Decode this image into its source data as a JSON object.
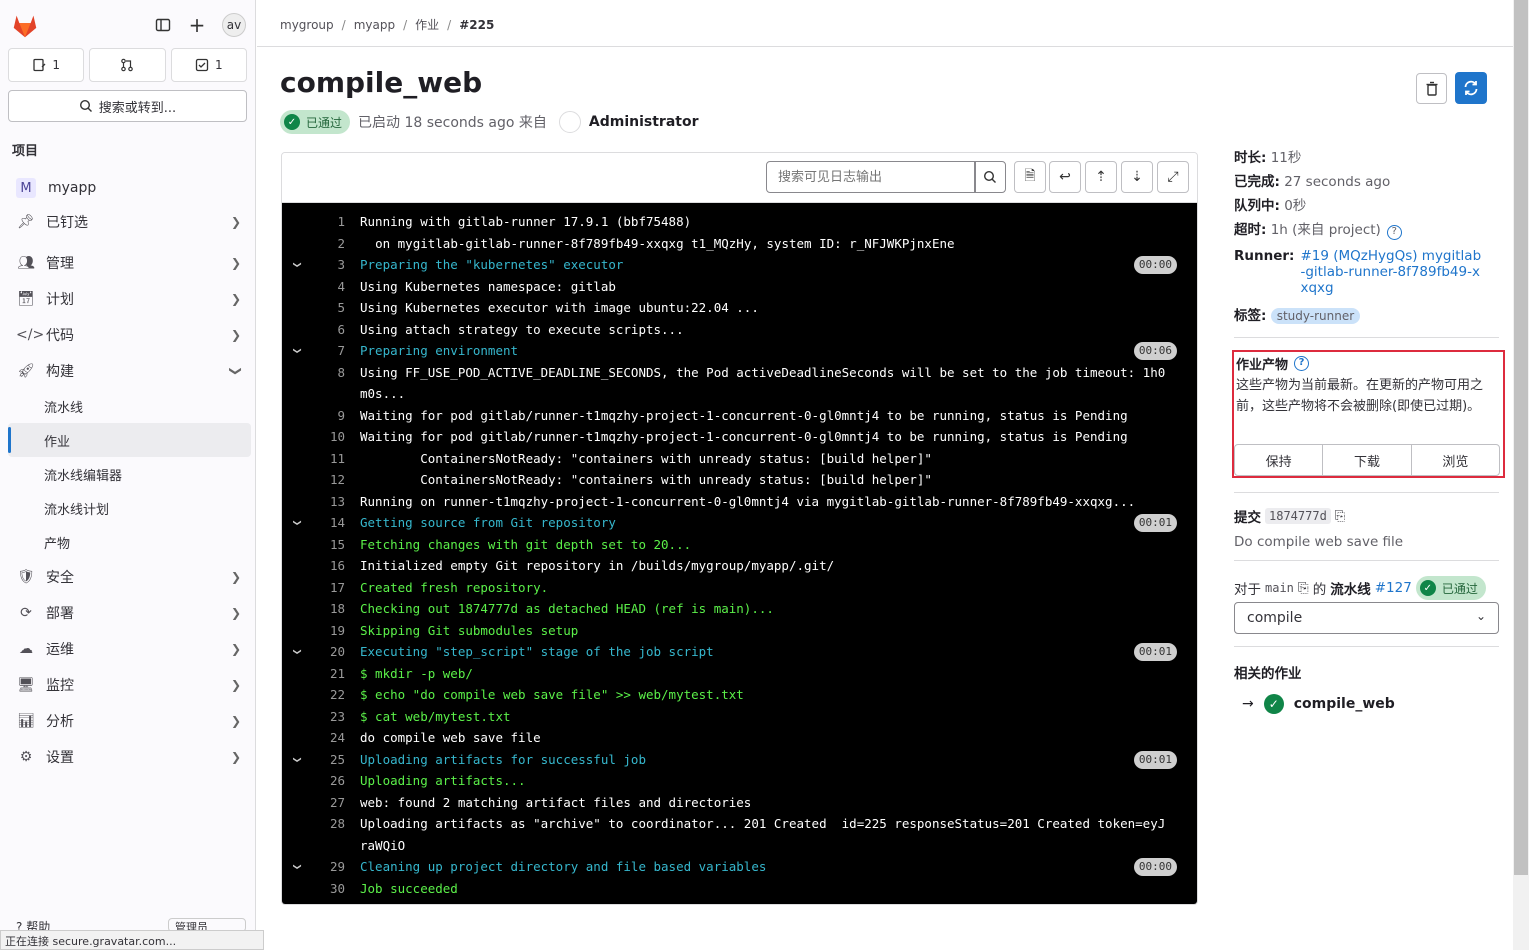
{
  "sidebar": {
    "avatar": "av",
    "counts": {
      "issues": "1",
      "mrs": "",
      "todos": "1"
    },
    "search_label": "搜索或转到...",
    "section_title": "项目",
    "project": {
      "initial": "M",
      "name": "myapp"
    },
    "items": [
      {
        "label": "已钉选"
      },
      {
        "label": "管理"
      },
      {
        "label": "计划"
      },
      {
        "label": "代码"
      },
      {
        "label": "构建"
      },
      {
        "label": "安全"
      },
      {
        "label": "部署"
      },
      {
        "label": "运维"
      },
      {
        "label": "监控"
      },
      {
        "label": "分析"
      },
      {
        "label": "设置"
      }
    ],
    "build_sub": [
      "流水线",
      "作业",
      "流水线编辑器",
      "流水线计划",
      "产物"
    ],
    "help": "帮助",
    "admin": "管理员"
  },
  "statusbar": "正在连接 secure.gravatar.com...",
  "breadcrumb": [
    "mygroup",
    "myapp",
    "作业",
    "#225"
  ],
  "job": {
    "title": "compile_web",
    "status": "已通过",
    "started": "已启动 18 seconds ago 来自",
    "user": "Administrator"
  },
  "log": {
    "search_placeholder": "搜索可见日志输出",
    "lines": [
      {
        "n": "1",
        "t": "Running with gitlab-runner 17.9.1 (bbf75488)",
        "c": "c-wht"
      },
      {
        "n": "2",
        "t": "  on mygitlab-gitlab-runner-8f789fb49-xxqxg t1_MQzHy, system ID: r_NFJWKPjnxEne",
        "c": "c-wht"
      },
      {
        "n": "3",
        "t": "Preparing the \"kubernetes\" executor",
        "c": "c-sec",
        "dur": "00:00"
      },
      {
        "n": "4",
        "t": "Using Kubernetes namespace: gitlab",
        "c": "c-wht"
      },
      {
        "n": "5",
        "t": "Using Kubernetes executor with image ubuntu:22.04 ...",
        "c": "c-wht"
      },
      {
        "n": "6",
        "t": "Using attach strategy to execute scripts...",
        "c": "c-wht"
      },
      {
        "n": "7",
        "t": "Preparing environment",
        "c": "c-sec",
        "dur": "00:06"
      },
      {
        "n": "8",
        "t": "Using FF_USE_POD_ACTIVE_DEADLINE_SECONDS, the Pod activeDeadlineSeconds will be set to the job timeout: 1h0m0s...",
        "c": "c-wht"
      },
      {
        "n": "9",
        "t": "Waiting for pod gitlab/runner-t1mqzhy-project-1-concurrent-0-gl0mntj4 to be running, status is Pending",
        "c": "c-wht"
      },
      {
        "n": "10",
        "t": "Waiting for pod gitlab/runner-t1mqzhy-project-1-concurrent-0-gl0mntj4 to be running, status is Pending",
        "c": "c-wht"
      },
      {
        "n": "11",
        "t": "        ContainersNotReady: \"containers with unready status: [build helper]\"",
        "c": "c-wht"
      },
      {
        "n": "12",
        "t": "        ContainersNotReady: \"containers with unready status: [build helper]\"",
        "c": "c-wht"
      },
      {
        "n": "13",
        "t": "Running on runner-t1mqzhy-project-1-concurrent-0-gl0mntj4 via mygitlab-gitlab-runner-8f789fb49-xxqxg...",
        "c": "c-wht"
      },
      {
        "n": "14",
        "t": "Getting source from Git repository",
        "c": "c-sec",
        "dur": "00:01"
      },
      {
        "n": "15",
        "t": "Fetching changes with git depth set to 20...",
        "c": "c-grn"
      },
      {
        "n": "16",
        "t": "Initialized empty Git repository in /builds/mygroup/myapp/.git/",
        "c": "c-wht"
      },
      {
        "n": "17",
        "t": "Created fresh repository.",
        "c": "c-grn"
      },
      {
        "n": "18",
        "t": "Checking out 1874777d as detached HEAD (ref is main)...",
        "c": "c-grn"
      },
      {
        "n": "19",
        "t": "Skipping Git submodules setup",
        "c": "c-grn"
      },
      {
        "n": "20",
        "t": "Executing \"step_script\" stage of the job script",
        "c": "c-sec",
        "dur": "00:01"
      },
      {
        "n": "21",
        "t": "$ mkdir -p web/",
        "c": "c-grn"
      },
      {
        "n": "22",
        "t": "$ echo \"do compile web save file\" >> web/mytest.txt",
        "c": "c-grn"
      },
      {
        "n": "23",
        "t": "$ cat web/mytest.txt",
        "c": "c-grn"
      },
      {
        "n": "24",
        "t": "do compile web save file",
        "c": "c-wht"
      },
      {
        "n": "25",
        "t": "Uploading artifacts for successful job",
        "c": "c-sec",
        "dur": "00:01"
      },
      {
        "n": "26",
        "t": "Uploading artifacts...",
        "c": "c-grn"
      },
      {
        "n": "27",
        "t": "web: found 2 matching artifact files and directories",
        "c": "c-wht"
      },
      {
        "n": "28",
        "t": "Uploading artifacts as \"archive\" to coordinator... 201 Created  id=225 responseStatus=201 Created token=eyJraWQiO",
        "c": "c-wht"
      },
      {
        "n": "29",
        "t": "Cleaning up project directory and file based variables",
        "c": "c-sec",
        "dur": "00:00"
      },
      {
        "n": "30",
        "t": "Job succeeded",
        "c": "c-grn"
      }
    ]
  },
  "details": {
    "duration_k": "时长:",
    "duration_v": "11秒",
    "finished_k": "已完成:",
    "finished_v": "27 seconds ago",
    "queued_k": "队列中:",
    "queued_v": "0秒",
    "timeout_k": "超时:",
    "timeout_v": "1h (来自 project)",
    "runner_k": "Runner:",
    "runner_v": "#19 (MQzHygQs) mygitlab-gitlab-runner-8f789fb49-xxqxg",
    "tags_k": "标签:",
    "tag": "study-runner"
  },
  "artifacts": {
    "title": "作业产物",
    "desc": "这些产物为当前最新。在更新的产物可用之前，这些产物将不会被删除(即使已过期)。",
    "keep": "保持",
    "download": "下载",
    "browse": "浏览"
  },
  "commit": {
    "label": "提交",
    "sha": "1874777d",
    "message": "Do compile web save file"
  },
  "pipeline": {
    "for": "对于",
    "ref": "main",
    "of": "的",
    "label": "流水线",
    "id": "#127",
    "status": "已通过"
  },
  "stage_select": "compile",
  "related": {
    "title": "相关的作业",
    "job": "compile_web"
  }
}
